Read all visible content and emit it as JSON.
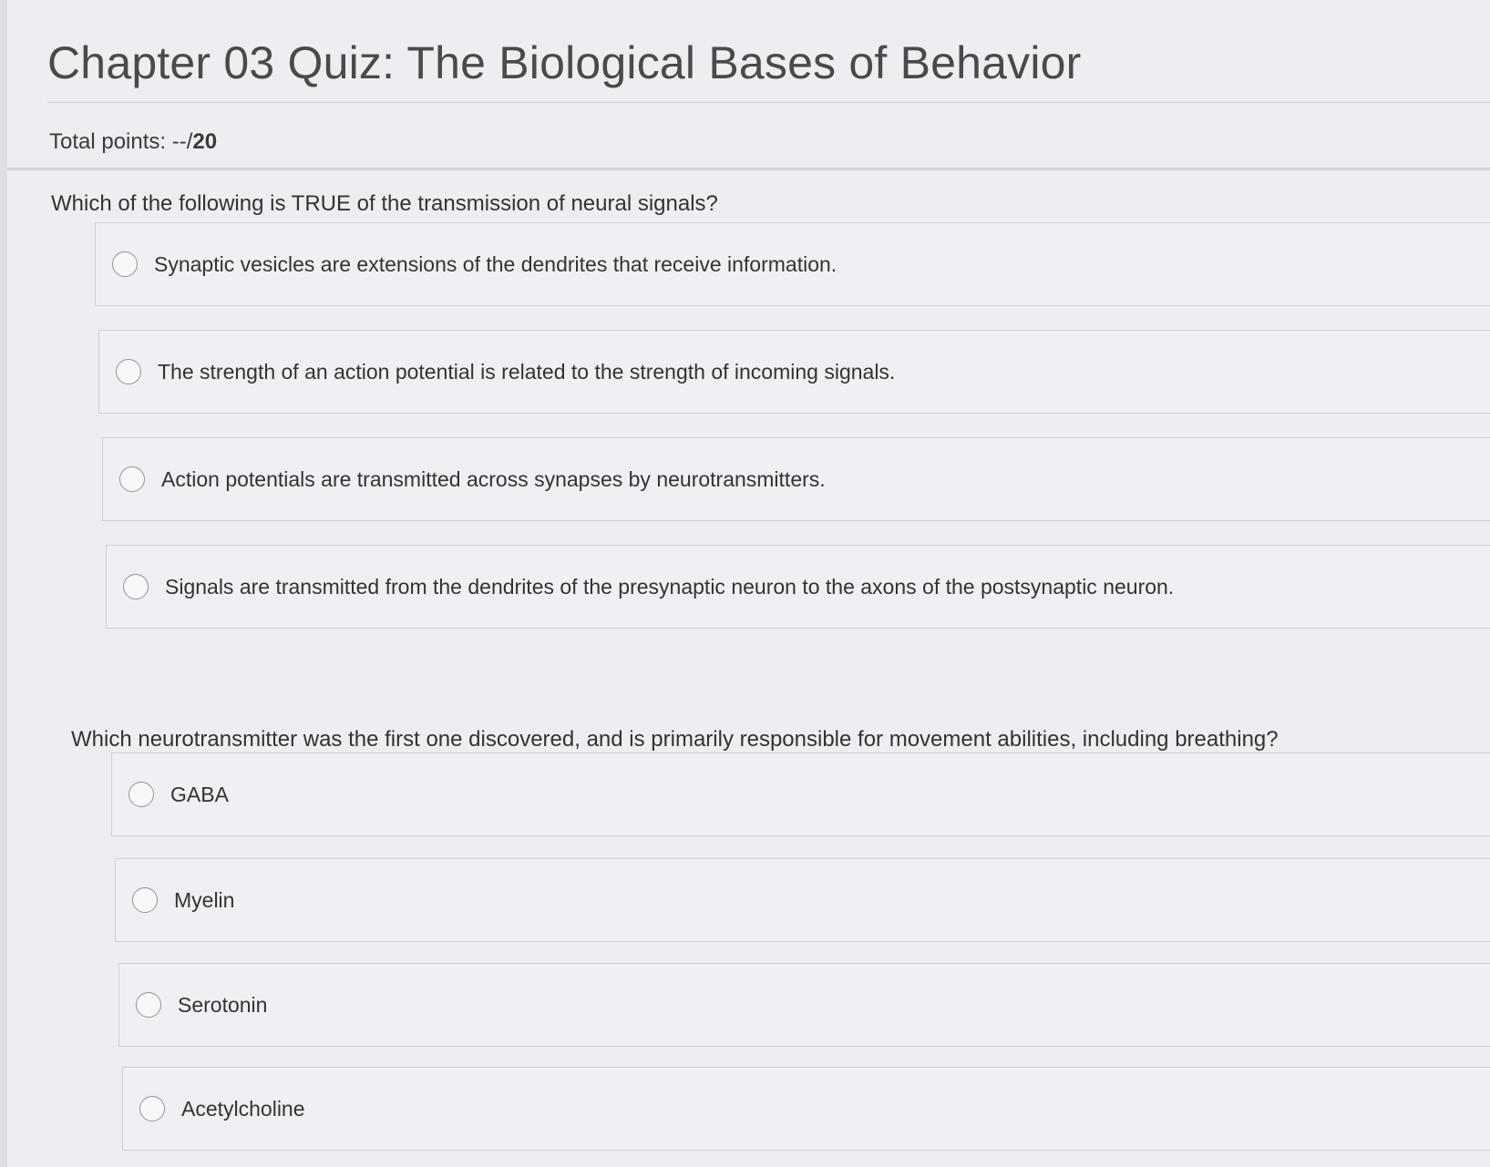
{
  "quiz": {
    "title": "Chapter 03 Quiz: The Biological Bases of Behavior",
    "points_label": "Total points: --/",
    "points_total": "20"
  },
  "questions": [
    {
      "text": "Which of the following is TRUE of the transmission of neural signals?",
      "options": [
        "Synaptic vesicles are extensions of the dendrites that receive information.",
        "The strength of an action potential is related to the strength of incoming signals.",
        "Action potentials are transmitted across synapses by neurotransmitters.",
        "Signals are transmitted from the dendrites of the presynaptic neuron to the axons of the postsynaptic neuron."
      ]
    },
    {
      "text": "Which neurotransmitter was the first one discovered, and is primarily responsible for movement abilities, including breathing?",
      "options": [
        "GABA",
        "Myelin",
        "Serotonin",
        "Acetylcholine"
      ]
    }
  ]
}
